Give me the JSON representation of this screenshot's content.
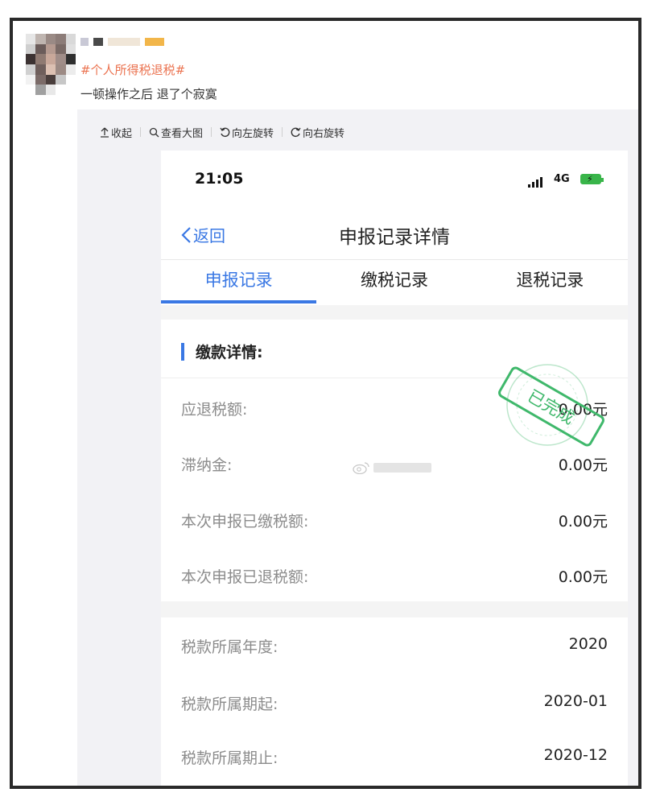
{
  "post": {
    "hashtag": "#个人所得税退税#",
    "text": "一顿操作之后 退了个寂寞"
  },
  "toolbar": {
    "collapse": "收起",
    "view_large": "查看大图",
    "rotate_left": "向左旋转",
    "rotate_right": "向右旋转"
  },
  "phone": {
    "status": {
      "time": "21:05",
      "network": "4G"
    },
    "nav": {
      "back": "返回",
      "title": "申报记录详情"
    },
    "tabs": [
      {
        "label": "申报记录",
        "active": true
      },
      {
        "label": "缴税记录",
        "active": false
      },
      {
        "label": "退税记录",
        "active": false
      }
    ],
    "payment_details": {
      "heading": "缴款详情:",
      "rows": [
        {
          "label": "应退税额:",
          "value": "0.00元"
        },
        {
          "label": "滞纳金:",
          "value": "0.00元"
        },
        {
          "label": "本次申报已缴税额:",
          "value": "0.00元"
        },
        {
          "label": "本次申报已退税额:",
          "value": "0.00元"
        }
      ]
    },
    "period_details": {
      "rows": [
        {
          "label": "税款所属年度:",
          "value": "2020"
        },
        {
          "label": "税款所属期起:",
          "value": "2020-01"
        },
        {
          "label": "税款所属期止:",
          "value": "2020-12"
        }
      ]
    },
    "stamp_text": "已完成"
  },
  "colors": {
    "accent": "#3a78e4",
    "hashtag": "#eb7350",
    "stamp": "#3fb86b"
  },
  "icons": {
    "collapse": "arrow-up-icon",
    "view_large": "magnifier-icon",
    "rotate_left": "rotate-left-icon",
    "rotate_right": "rotate-right-icon",
    "back": "chevron-left-icon",
    "signal": "signal-bars-icon",
    "battery": "battery-charging-icon",
    "weibo": "weibo-logo-icon"
  }
}
